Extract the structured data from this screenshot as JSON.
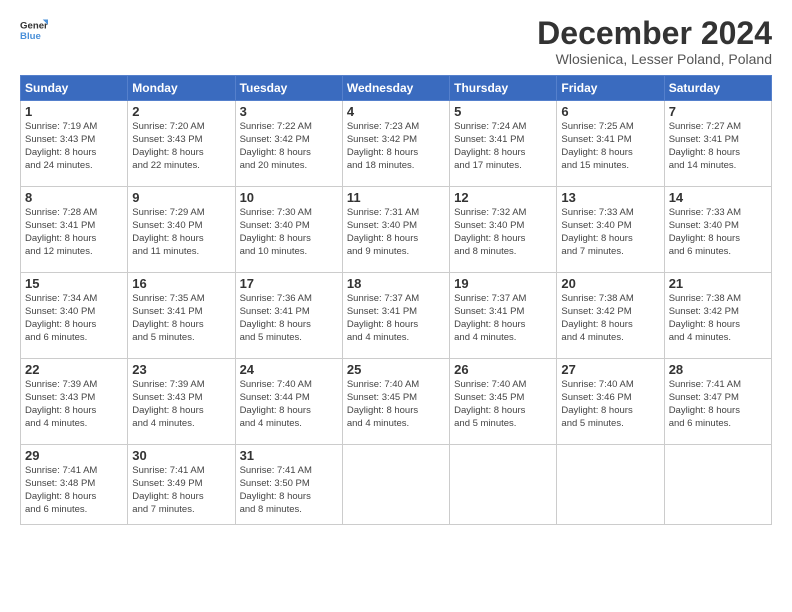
{
  "header": {
    "logo_general": "General",
    "logo_blue": "Blue",
    "month_title": "December 2024",
    "subtitle": "Wlosienica, Lesser Poland, Poland"
  },
  "weekdays": [
    "Sunday",
    "Monday",
    "Tuesday",
    "Wednesday",
    "Thursday",
    "Friday",
    "Saturday"
  ],
  "weeks": [
    [
      {
        "day": "1",
        "info": "Sunrise: 7:19 AM\nSunset: 3:43 PM\nDaylight: 8 hours\nand 24 minutes."
      },
      {
        "day": "2",
        "info": "Sunrise: 7:20 AM\nSunset: 3:43 PM\nDaylight: 8 hours\nand 22 minutes."
      },
      {
        "day": "3",
        "info": "Sunrise: 7:22 AM\nSunset: 3:42 PM\nDaylight: 8 hours\nand 20 minutes."
      },
      {
        "day": "4",
        "info": "Sunrise: 7:23 AM\nSunset: 3:42 PM\nDaylight: 8 hours\nand 18 minutes."
      },
      {
        "day": "5",
        "info": "Sunrise: 7:24 AM\nSunset: 3:41 PM\nDaylight: 8 hours\nand 17 minutes."
      },
      {
        "day": "6",
        "info": "Sunrise: 7:25 AM\nSunset: 3:41 PM\nDaylight: 8 hours\nand 15 minutes."
      },
      {
        "day": "7",
        "info": "Sunrise: 7:27 AM\nSunset: 3:41 PM\nDaylight: 8 hours\nand 14 minutes."
      }
    ],
    [
      {
        "day": "8",
        "info": "Sunrise: 7:28 AM\nSunset: 3:41 PM\nDaylight: 8 hours\nand 12 minutes."
      },
      {
        "day": "9",
        "info": "Sunrise: 7:29 AM\nSunset: 3:40 PM\nDaylight: 8 hours\nand 11 minutes."
      },
      {
        "day": "10",
        "info": "Sunrise: 7:30 AM\nSunset: 3:40 PM\nDaylight: 8 hours\nand 10 minutes."
      },
      {
        "day": "11",
        "info": "Sunrise: 7:31 AM\nSunset: 3:40 PM\nDaylight: 8 hours\nand 9 minutes."
      },
      {
        "day": "12",
        "info": "Sunrise: 7:32 AM\nSunset: 3:40 PM\nDaylight: 8 hours\nand 8 minutes."
      },
      {
        "day": "13",
        "info": "Sunrise: 7:33 AM\nSunset: 3:40 PM\nDaylight: 8 hours\nand 7 minutes."
      },
      {
        "day": "14",
        "info": "Sunrise: 7:33 AM\nSunset: 3:40 PM\nDaylight: 8 hours\nand 6 minutes."
      }
    ],
    [
      {
        "day": "15",
        "info": "Sunrise: 7:34 AM\nSunset: 3:40 PM\nDaylight: 8 hours\nand 6 minutes."
      },
      {
        "day": "16",
        "info": "Sunrise: 7:35 AM\nSunset: 3:41 PM\nDaylight: 8 hours\nand 5 minutes."
      },
      {
        "day": "17",
        "info": "Sunrise: 7:36 AM\nSunset: 3:41 PM\nDaylight: 8 hours\nand 5 minutes."
      },
      {
        "day": "18",
        "info": "Sunrise: 7:37 AM\nSunset: 3:41 PM\nDaylight: 8 hours\nand 4 minutes."
      },
      {
        "day": "19",
        "info": "Sunrise: 7:37 AM\nSunset: 3:41 PM\nDaylight: 8 hours\nand 4 minutes."
      },
      {
        "day": "20",
        "info": "Sunrise: 7:38 AM\nSunset: 3:42 PM\nDaylight: 8 hours\nand 4 minutes."
      },
      {
        "day": "21",
        "info": "Sunrise: 7:38 AM\nSunset: 3:42 PM\nDaylight: 8 hours\nand 4 minutes."
      }
    ],
    [
      {
        "day": "22",
        "info": "Sunrise: 7:39 AM\nSunset: 3:43 PM\nDaylight: 8 hours\nand 4 minutes."
      },
      {
        "day": "23",
        "info": "Sunrise: 7:39 AM\nSunset: 3:43 PM\nDaylight: 8 hours\nand 4 minutes."
      },
      {
        "day": "24",
        "info": "Sunrise: 7:40 AM\nSunset: 3:44 PM\nDaylight: 8 hours\nand 4 minutes."
      },
      {
        "day": "25",
        "info": "Sunrise: 7:40 AM\nSunset: 3:45 PM\nDaylight: 8 hours\nand 4 minutes."
      },
      {
        "day": "26",
        "info": "Sunrise: 7:40 AM\nSunset: 3:45 PM\nDaylight: 8 hours\nand 5 minutes."
      },
      {
        "day": "27",
        "info": "Sunrise: 7:40 AM\nSunset: 3:46 PM\nDaylight: 8 hours\nand 5 minutes."
      },
      {
        "day": "28",
        "info": "Sunrise: 7:41 AM\nSunset: 3:47 PM\nDaylight: 8 hours\nand 6 minutes."
      }
    ],
    [
      {
        "day": "29",
        "info": "Sunrise: 7:41 AM\nSunset: 3:48 PM\nDaylight: 8 hours\nand 6 minutes."
      },
      {
        "day": "30",
        "info": "Sunrise: 7:41 AM\nSunset: 3:49 PM\nDaylight: 8 hours\nand 7 minutes."
      },
      {
        "day": "31",
        "info": "Sunrise: 7:41 AM\nSunset: 3:50 PM\nDaylight: 8 hours\nand 8 minutes."
      },
      null,
      null,
      null,
      null
    ]
  ]
}
